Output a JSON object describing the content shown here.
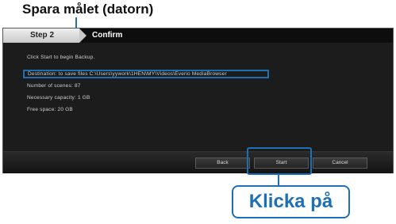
{
  "annotations": {
    "top": "Spara målet (datorn)",
    "bottom": "Klicka på"
  },
  "wizard": {
    "step_label": "Step 2",
    "current_step": "Confirm",
    "lines": [
      "Click Start to begin Backup.",
      "Destination: to save files C:\\Users\\yywork\\1HEN\\MY\\Videos\\Everio MediaBrowser",
      "Number of scenes: 87",
      "Necessary capacity: 1 GB",
      "Free space: 20 GB"
    ],
    "buttons": {
      "back": "Back",
      "start": "Start",
      "cancel": "Cancel"
    }
  },
  "colors": {
    "callout": "#1f6fb5",
    "window_bg": "#1c1c1c"
  }
}
